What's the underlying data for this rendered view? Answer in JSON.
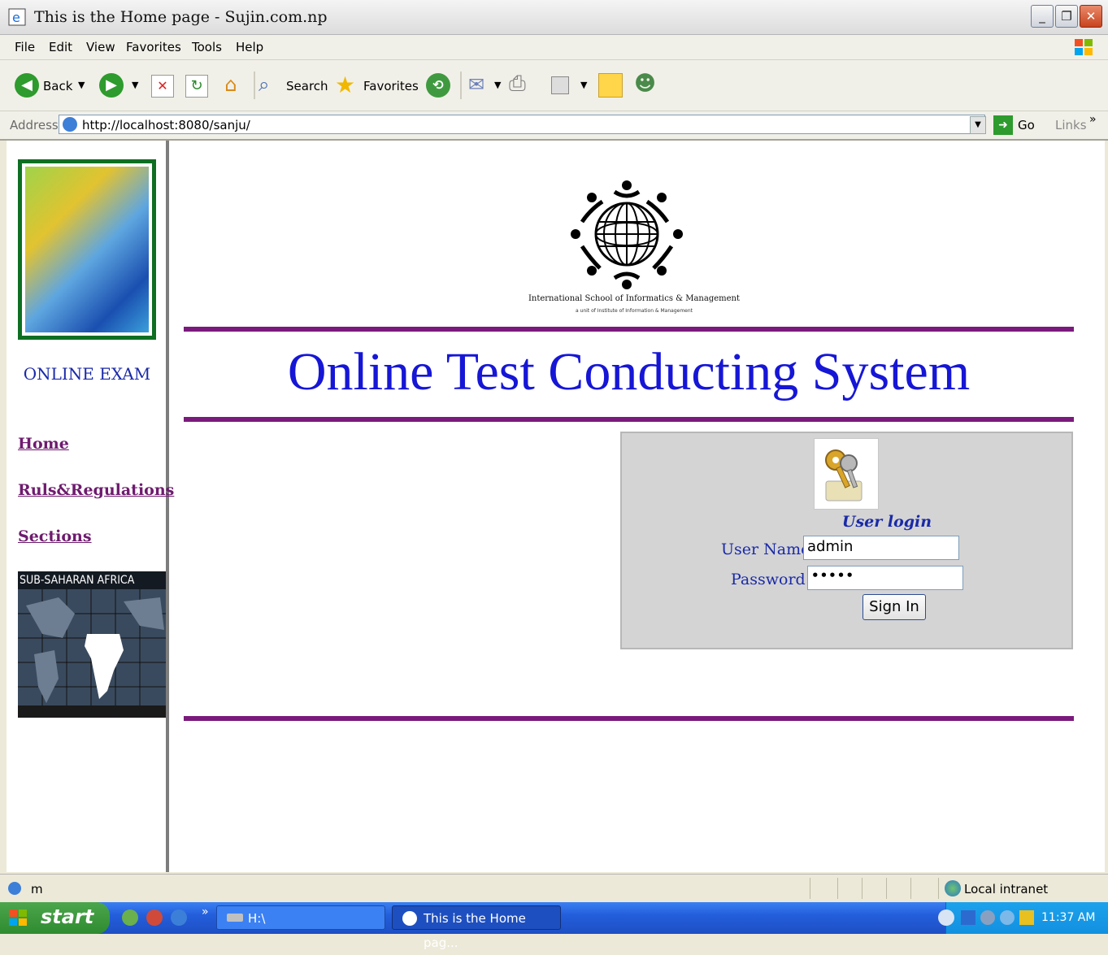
{
  "window": {
    "title": "This is the Home page - Sujin.com.np"
  },
  "menu": [
    "File",
    "Edit",
    "View",
    "Favorites",
    "Tools",
    "Help"
  ],
  "toolbar": {
    "back": "Back",
    "search": "Search",
    "favorites": "Favorites"
  },
  "address": {
    "label": "Address",
    "url": "http://localhost:8080/sanju/",
    "go": "Go",
    "links": "Links"
  },
  "sidebar": {
    "heading": "ONLINE EXAM",
    "links": [
      "Home",
      "Ruls&Regulations",
      "Sections"
    ],
    "map_caption": "SUB-SAHARAN AFRICA"
  },
  "logo": {
    "line1": "International School of Informatics & Management",
    "line2": "a unit of Institute of Information & Management"
  },
  "main": {
    "title": "Online Test Conducting System"
  },
  "login": {
    "heading": "User login",
    "username_label": "User Name",
    "username_value": "admin",
    "password_label": "Password",
    "password_mask": "•••••",
    "submit": "Sign In"
  },
  "status": {
    "text": "m",
    "zone": "Local intranet"
  },
  "taskbar": {
    "start": "start",
    "item1": "H:\\",
    "item2": "This is the Home pag...",
    "clock": "11:37 AM"
  },
  "colors": {
    "title_blue": "#1616d6",
    "divider_purple": "#7a1a7c",
    "link_purple": "#6e1b6e"
  }
}
